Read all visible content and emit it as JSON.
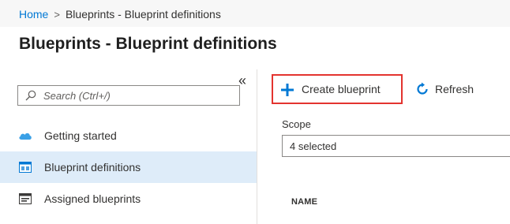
{
  "breadcrumb": {
    "home": "Home",
    "separator": ">",
    "current": "Blueprints - Blueprint definitions"
  },
  "page": {
    "title": "Blueprints - Blueprint definitions"
  },
  "sidebar": {
    "search_placeholder": "Search (Ctrl+/)",
    "collapse_glyph": "«",
    "items": [
      {
        "label": "Getting started",
        "icon": "cloud-icon",
        "active": false
      },
      {
        "label": "Blueprint definitions",
        "icon": "blueprint-definitions-icon",
        "active": true
      },
      {
        "label": "Assigned blueprints",
        "icon": "assigned-blueprints-icon",
        "active": false
      }
    ]
  },
  "toolbar": {
    "create_label": "Create blueprint",
    "refresh_label": "Refresh"
  },
  "filters": {
    "scope_label": "Scope",
    "scope_value": "4 selected"
  },
  "table": {
    "columns": [
      "NAME"
    ]
  },
  "colors": {
    "accent": "#0078d4",
    "highlight_border": "#e3342f",
    "active_nav_bg": "#deecf9"
  }
}
